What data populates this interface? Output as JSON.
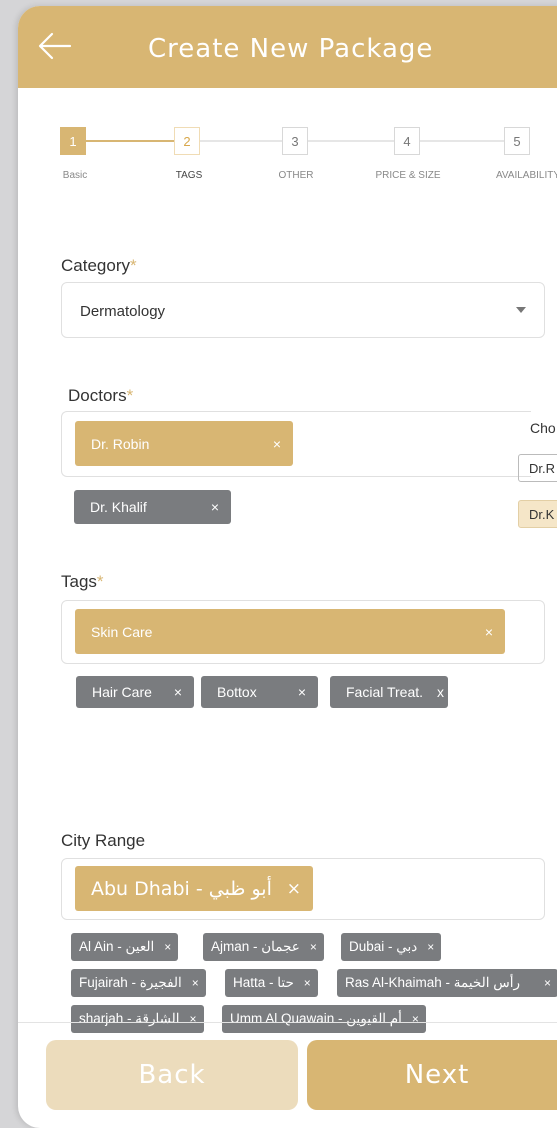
{
  "header": {
    "title": "Create New Package"
  },
  "steps": [
    {
      "number": "1",
      "label": "Basic"
    },
    {
      "number": "2",
      "label": "TAGS"
    },
    {
      "number": "3",
      "label": "OTHER"
    },
    {
      "number": "4",
      "label": "PRICE & SIZE"
    },
    {
      "number": "5",
      "label": "AVAILABILITY"
    }
  ],
  "category": {
    "label": "Category",
    "required": "*",
    "value": "Dermatology"
  },
  "doctors": {
    "label": "Doctors",
    "required": "*",
    "selected": [
      {
        "name": "Dr. Robin",
        "remove": "×"
      }
    ],
    "options": [
      {
        "name": "Dr. Khalif",
        "remove": "×"
      }
    ],
    "dropdown": {
      "label": "Cho",
      "items": [
        "Dr.R",
        "Dr.K"
      ]
    }
  },
  "tags": {
    "label": "Tags",
    "required": "*",
    "selected": [
      {
        "name": "Skin Care",
        "remove": "×"
      }
    ],
    "options": [
      {
        "name": "Hair Care",
        "remove": "×"
      },
      {
        "name": "Bottox",
        "remove": "×"
      },
      {
        "name": "Facial Treat.",
        "remove": "x"
      }
    ]
  },
  "city_range": {
    "label": "City Range",
    "selected": [
      {
        "name": "Abu Dhabi - أبو ظبي",
        "remove": "×"
      }
    ],
    "options": [
      {
        "name": "Al Ain - العين",
        "remove": "×"
      },
      {
        "name": "Ajman - عجمان",
        "remove": "×"
      },
      {
        "name": "Dubai - دبي",
        "remove": "×"
      },
      {
        "name": "Fujairah - الفجيرة",
        "remove": "×"
      },
      {
        "name": "Hatta - حتا",
        "remove": "×"
      },
      {
        "name": "Ras Al-Khaimah - رأس الخيمة",
        "remove": "×"
      },
      {
        "name": "sharjah - الشارقة",
        "remove": "×"
      },
      {
        "name": "Umm Al Quawain - أم القيوين",
        "remove": "×"
      }
    ]
  },
  "footer": {
    "back_label": "Back",
    "next_label": "Next"
  },
  "colors": {
    "accent": "#d8b673",
    "chip_grey": "#7a7c7f",
    "light_accent": "#ecdcbc"
  }
}
